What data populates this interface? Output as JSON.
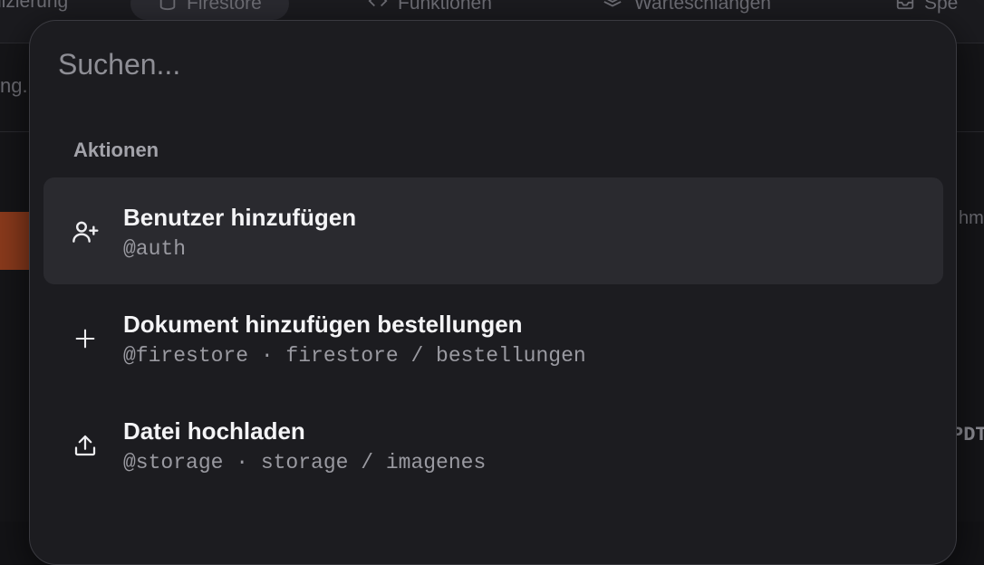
{
  "top_nav": {
    "tabs": [
      {
        "label": "nizierung",
        "icon": "none"
      },
      {
        "label": "Firestore",
        "icon": "database-icon",
        "active": true
      },
      {
        "label": "Funktionen",
        "icon": "code-icon"
      },
      {
        "label": "Warteschlangen",
        "icon": "layers-icon"
      },
      {
        "label": "Spe",
        "icon": "inbox-icon"
      }
    ]
  },
  "background": {
    "left_text": "ng.",
    "right_text_1": "hm",
    "right_text_2": "PDT"
  },
  "palette": {
    "search": {
      "placeholder": "Suchen...",
      "value": ""
    },
    "section_label": "Aktionen",
    "items": [
      {
        "title": "Benutzer hinzufügen",
        "subtitle": "@auth",
        "icon": "user-plus-icon",
        "selected": true
      },
      {
        "title": "Dokument hinzufügen bestellungen",
        "subtitle": "@firestore · firestore / bestellungen",
        "icon": "plus-icon",
        "selected": false
      },
      {
        "title": "Datei hochladen",
        "subtitle": "@storage · storage / imagenes",
        "icon": "upload-icon",
        "selected": false
      }
    ]
  },
  "colors": {
    "palette_bg": "#1c1c20",
    "selected_bg": "#2a2a2f",
    "accent_orange": "#8a3a1c"
  }
}
